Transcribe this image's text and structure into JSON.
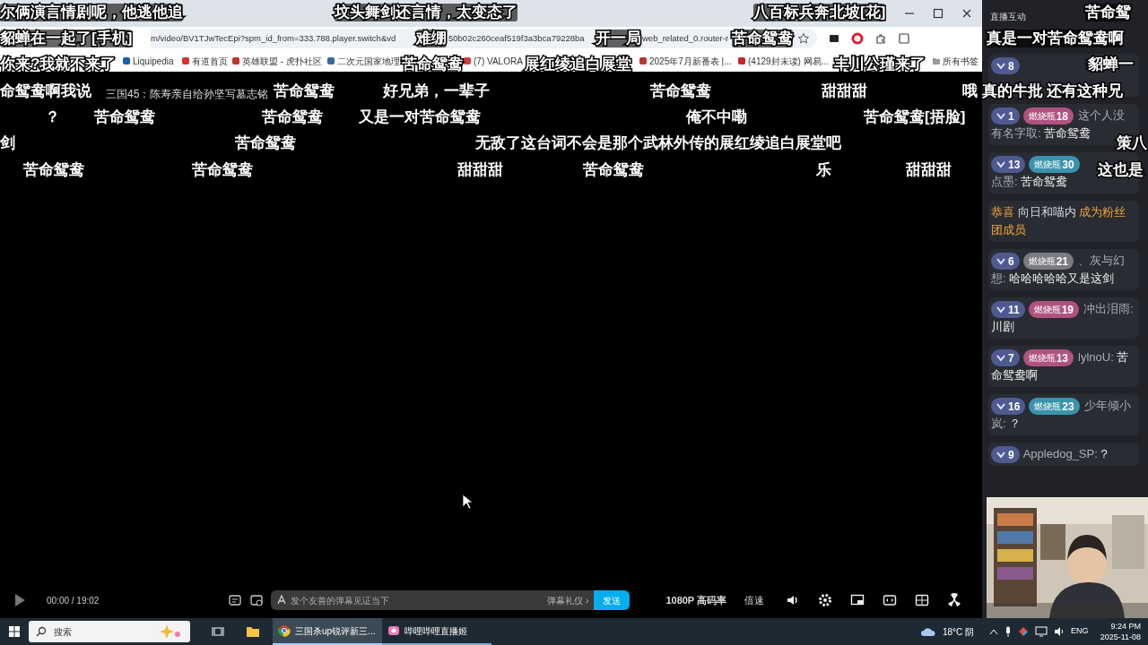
{
  "browser": {
    "address_fragments": [
      "m/video/BV1TJwTecEpi?spm_id_from=333.788.player.switch&vd",
      "50b02c260ceaf519f3a3bca79228ba",
      "web_related_0.router-r"
    ],
    "bookmarks": [
      "Liquipedia",
      "有道首页",
      "英雄联盟 - 虎扑社区",
      "二次元国家地理",
      "(7) VALORA",
      "2025年7月新番表 |...",
      "(4129封未读) 网易...",
      "所有书签"
    ]
  },
  "player": {
    "title": "三国45：陈寿亲自给孙坚写墓志铭",
    "time": "00:00 / 19:02",
    "danmaku_placeholder": "发个友善的弹幕见证当下",
    "etiquette": "弹幕礼仪 ›",
    "send": "发送",
    "quality": "1080P 高码率",
    "speed": "倍速"
  },
  "danmaku_rows": [
    [
      "尔俩演言情剧呢，他逃他追",
      "坟头舞剑还言情，太变态了",
      "八百标兵奔北坡[花]",
      "苦命鸳"
    ],
    [
      "貂蝉在一起了[手机]",
      "难绷",
      "开一局",
      "苦命鸳鸯",
      "真是一对苦命鸳鸯啊"
    ],
    [
      "你来?我就不来了",
      "苦命鸳鸯",
      "展红绫追白展堂",
      "丰川公瑾来了",
      "貂蝉一"
    ],
    [
      "命鸳鸯啊我说",
      "苦命鸳鸯",
      "好兄弟，一辈子",
      "苦命鸳鸯",
      "甜甜甜",
      "哦 真的牛批 还有这种兄"
    ],
    [
      "？",
      "苦命鸳鸯",
      "苦命鸳鸯",
      "又是一对苦命鸳鸯",
      "俺不中嘞",
      "苦命鸳鸯[捂脸]"
    ],
    [
      "剑",
      "苦命鸳鸯",
      "无敌了这台词不会是那个武林外传的展红绫追白展堂吧",
      "策八"
    ],
    [
      "苦命鸳鸯",
      "苦命鸳鸯",
      "甜甜甜",
      "苦命鸳鸯",
      "乐",
      "甜甜甜",
      "这也是"
    ]
  ],
  "chat": {
    "title": "直播互动",
    "items": [
      {
        "kind": "message",
        "level": "8"
      },
      {
        "kind": "message",
        "level": "1",
        "medal": {
          "name": "燃烧瓶",
          "level": "18",
          "color": "#b0527f"
        },
        "user": "这个人没有名字取:",
        "text": "苦命鸳鸯"
      },
      {
        "kind": "message",
        "level": "13",
        "medal": {
          "name": "燃烧瓶",
          "level": "30",
          "color": "#3a93ad"
        },
        "user": "点墨:",
        "text": "苦命鸳鸯"
      },
      {
        "kind": "notice",
        "prefix": "恭喜",
        "user": "向日和喵内",
        "suffix": "成为粉丝团成员"
      },
      {
        "kind": "message",
        "level": "6",
        "medal": {
          "name": "燃烧瓶",
          "level": "21",
          "color": "#7b7b82"
        },
        "user": "、灰与幻想:",
        "text": "哈哈哈哈哈又是这剑"
      },
      {
        "kind": "message",
        "level": "11",
        "medal": {
          "name": "燃烧瓶",
          "level": "19",
          "color": "#b0527f"
        },
        "user": "冲出泪雨:",
        "text": "川剧"
      },
      {
        "kind": "message",
        "level": "7",
        "medal": {
          "name": "燃烧瓶",
          "level": "13",
          "color": "#b0527f"
        },
        "user": "lylnoU:",
        "text": "苦命鸳鸯啊"
      },
      {
        "kind": "message",
        "level": "16",
        "medal": {
          "name": "燃烧瓶",
          "level": "23",
          "color": "#3a93ad"
        },
        "user": "少年倾小岚:",
        "text": "？"
      },
      {
        "kind": "message",
        "level": "9",
        "user": "Appledog_SP:",
        "text": "?"
      }
    ]
  },
  "taskbar": {
    "search": "搜索",
    "apps": [
      {
        "label": "三国杀up锐评新三...",
        "selected": true
      },
      {
        "label": "哔哩哔哩直播姬",
        "selected": false
      }
    ],
    "weather": "18°C 阴",
    "language": "ENG",
    "time": "9:24 PM",
    "date": "2025-11-08"
  }
}
